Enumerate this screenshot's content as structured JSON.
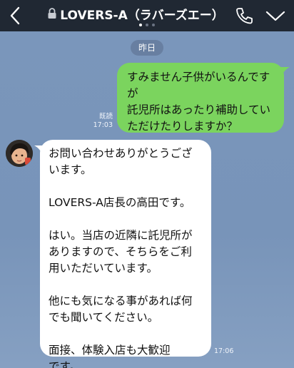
{
  "header": {
    "title": "LOVERS-A（ラバーズエー）",
    "back_icon": "chevron-left-icon",
    "lock_icon": "lock-icon",
    "call_icon": "phone-icon",
    "menu_icon": "chevron-down-icon"
  },
  "chat": {
    "date_label": "昨日",
    "messages": [
      {
        "direction": "outgoing",
        "text": "すみません子供がいるんです\nが\n託児所はあったり補助してい\nただけたりしますか？",
        "read_label": "既読",
        "time": "17:03"
      },
      {
        "direction": "incoming",
        "text": "お問い合わせありがとうござ\nいます。\n\nLOVERS-A店長の高田です。\n\nはい。当店の近隣に託児所が\nありますので、そちらをご利\n用いただいています。\n\n他にも気になる事があれば何\nでも聞いてください。\n\n面接、体験入店も大歓迎\nです。",
        "time": "17:06"
      }
    ]
  },
  "colors": {
    "header_bg": "#202833",
    "chat_bg": "#7a96bb",
    "outgoing_bubble": "#7bd45e",
    "incoming_bubble": "#ffffff"
  }
}
